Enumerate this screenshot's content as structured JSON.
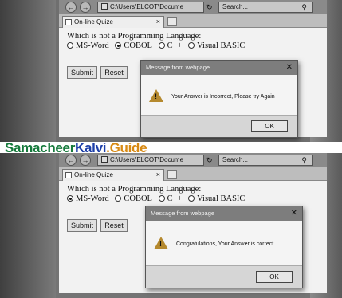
{
  "colors": {
    "watermark_green": "#167a3c",
    "watermark_blue": "#1d3fa8",
    "watermark_orange": "#d88a14",
    "warning_icon": "#b5892e"
  },
  "watermark": {
    "part1": "Samacheer",
    "part2": "Kalvi",
    "part3": ".Guide"
  },
  "screens": [
    {
      "browser": {
        "url": "C:\\Users\\ELCOT\\Docume",
        "refresh_glyph": "→ ↻",
        "search_placeholder": "Search...",
        "tab_title": "On-line Quize",
        "tab_close": "×"
      },
      "quiz": {
        "question": "Which is not a Programming Language:",
        "options": [
          "MS-Word",
          "COBOL",
          "C++",
          "Visual BASIC"
        ],
        "selected_index": 1,
        "submit_label": "Submit",
        "reset_label": "Reset"
      },
      "dialog": {
        "title": "Message from webpage",
        "message": "Your Answer is Incorrect, Please try Again",
        "ok_label": "OK",
        "close_glyph": "✕",
        "icon": "warning-icon"
      }
    },
    {
      "browser": {
        "url": "C:\\Users\\ELCOT\\Docume",
        "refresh_glyph": "→ ↻",
        "search_placeholder": "Search...",
        "tab_title": "On-line Quize",
        "tab_close": "×"
      },
      "quiz": {
        "question": "Which is not a Programming Language:",
        "options": [
          "MS-Word",
          "COBOL",
          "C++",
          "Visual BASIC"
        ],
        "selected_index": 0,
        "submit_label": "Submit",
        "reset_label": "Reset"
      },
      "dialog": {
        "title": "Message from webpage",
        "message": "Congratulations, Your Answer is correct",
        "ok_label": "OK",
        "close_glyph": "✕",
        "icon": "warning-icon"
      }
    }
  ]
}
